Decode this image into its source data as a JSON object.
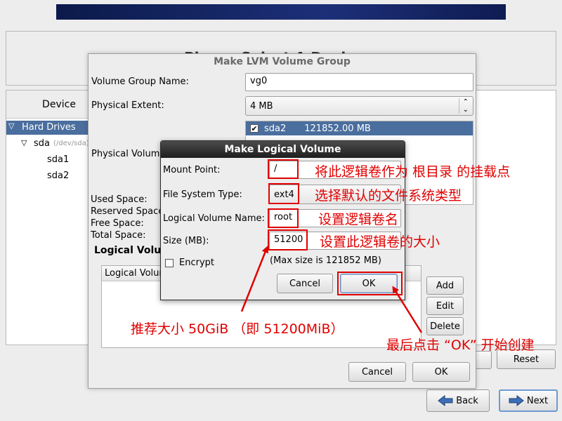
{
  "background": {
    "partial_title": "Please Select A Device",
    "device_header": "Device",
    "tree": {
      "hard_drives": "Hard Drives",
      "sda": "sda",
      "sda_path": "(/dev/sda)",
      "sda1": "sda1",
      "sda2": "sda2"
    },
    "reset_label": "Reset",
    "back_label": "Back",
    "next_label": "Next"
  },
  "lvm_dialog": {
    "title": "Make LVM Volume Group",
    "vg_name_label": "Volume Group Name:",
    "vg_name_value": "vg0",
    "pe_label": "Physical Extent:",
    "pe_value": "4 MB",
    "pv_label": "Physical Volumes to Use:",
    "pv_row": {
      "name": "sda2",
      "size": "121852.00 MB",
      "checked": true
    },
    "used_space_label": "Used Space:",
    "reserved_space_label": "Reserved Space:",
    "free_space_label": "Free Space:",
    "total_space_label": "Total Space:",
    "lv_section_label": "Logical Volumes",
    "lv_column_label": "Logical Volume Name",
    "add_label": "Add",
    "edit_label": "Edit",
    "delete_label": "Delete",
    "cancel_label": "Cancel",
    "ok_label": "OK"
  },
  "mlv_dialog": {
    "title": "Make Logical Volume",
    "mount_label": "Mount Point:",
    "mount_value": "/",
    "fs_label": "File System Type:",
    "fs_value": "ext4",
    "name_label": "Logical Volume Name:",
    "name_value": "root",
    "size_label": "Size (MB):",
    "size_value": "51200",
    "encrypt_label": "Encrypt",
    "max_size_text": "(Max size is 121852 MB)",
    "cancel_label": "Cancel",
    "ok_label": "OK"
  },
  "annotations": {
    "mount": "将此逻辑卷作为 根目录 的挂载点",
    "fs": "选择默认的文件系统类型",
    "name": "设置逻辑卷名",
    "size": "设置此逻辑卷的大小",
    "recommend": "推荐大小 50GiB （即 51200MiB）",
    "final": "最后点击 “OK” 开始创建"
  },
  "colors": {
    "annotation_red": "#e00000",
    "selection_blue": "#4a6e9e"
  }
}
